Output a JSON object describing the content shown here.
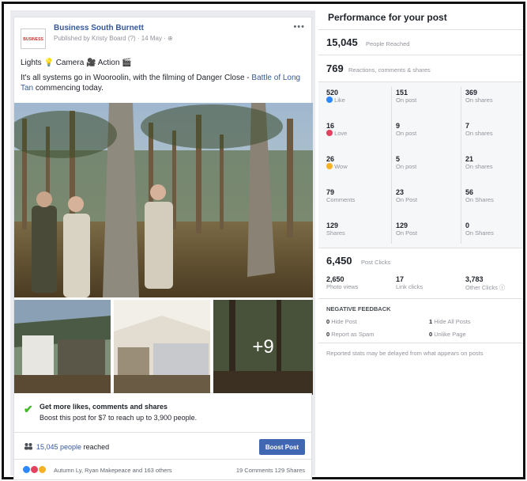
{
  "post": {
    "page_name": "Business South Burnett",
    "published": "Published by Kristy Board (?) · 14 May · ⊕",
    "logo_text": "BUSINESS",
    "more": "•••",
    "line1": "Lights 💡 Camera 🎥 Action 🎬",
    "line2_text": "It's all systems go in Wooroolin, with the filming of Danger Close - ",
    "line2_link": "Battle of Long Tan",
    "line2_end": " commencing today.",
    "more_photos": "+9"
  },
  "boost": {
    "title": "Get more likes, comments and shares",
    "subtitle": "Boost this post for $7 to reach up to 3,900 people."
  },
  "reach_row": {
    "count": "15,045 people",
    "suffix": "reached",
    "button": "Boost Post"
  },
  "reactions_row": {
    "names": "Autumn Ly, Ryan Makepeace and 163 others",
    "counts": "19 Comments 129 Shares"
  },
  "performance": {
    "title": "Performance for your post",
    "people_reached": "15,045",
    "people_reached_label": "People Reached",
    "reactions_total": "769",
    "reactions_label": "Reactions, comments & shares",
    "rows": [
      {
        "n1": "520",
        "l1": "Like",
        "n2": "151",
        "l2": "On post",
        "n3": "369",
        "l3": "On shares"
      },
      {
        "n1": "16",
        "l1": "Love",
        "n2": "9",
        "l2": "On post",
        "n3": "7",
        "l3": "On shares"
      },
      {
        "n1": "26",
        "l1": "Wow",
        "n2": "5",
        "l2": "On post",
        "n3": "21",
        "l3": "On shares"
      },
      {
        "n1": "79",
        "l1": "Comments",
        "n2": "23",
        "l2": "On Post",
        "n3": "56",
        "l3": "On Shares"
      },
      {
        "n1": "129",
        "l1": "Shares",
        "n2": "129",
        "l2": "On Post",
        "n3": "0",
        "l3": "On Shares"
      }
    ],
    "post_clicks": "6,450",
    "post_clicks_label": "Post Clicks",
    "clicks": [
      {
        "n": "2,650",
        "l": "Photo views"
      },
      {
        "n": "17",
        "l": "Link clicks"
      },
      {
        "n": "3,783",
        "l": "Other Clicks ⓘ"
      }
    ],
    "negative_title": "NEGATIVE FEEDBACK",
    "negative": [
      {
        "n": "0",
        "l": "Hide Post"
      },
      {
        "n": "1",
        "l": "Hide All Posts"
      },
      {
        "n": "0",
        "l": "Report as Spam"
      },
      {
        "n": "0",
        "l": "Unlike Page"
      }
    ],
    "note": "Reported stats may be delayed from what appears on posts"
  },
  "colors": {
    "link": "#365899",
    "button": "#4267b2",
    "like": "#2d88ff",
    "love": "#e4405f",
    "wow": "#f7b125"
  }
}
